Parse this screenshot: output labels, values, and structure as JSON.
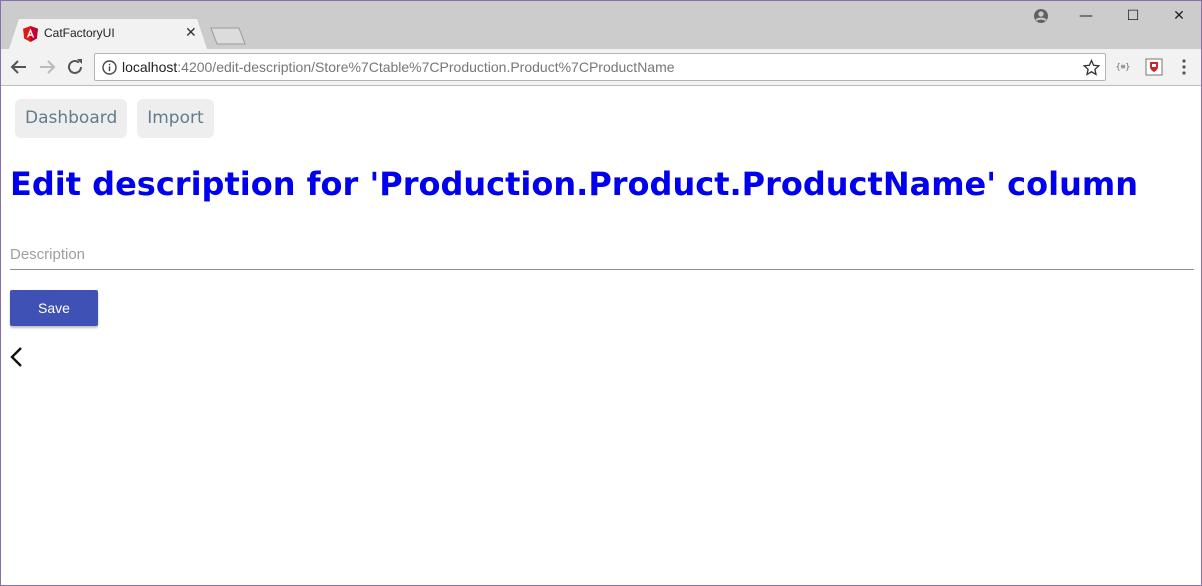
{
  "browser": {
    "tab_title": "CatFactoryUI",
    "url_host": "localhost",
    "url_rest": ":4200/edit-description/Store%7Ctable%7CProduction.Product%7CProductName",
    "window_controls": {
      "minimize": "—",
      "maximize": "☐",
      "close": "✕"
    },
    "extension_label": "{≡}"
  },
  "nav": {
    "items": [
      {
        "label": "Dashboard"
      },
      {
        "label": "Import"
      }
    ]
  },
  "page": {
    "heading": "Edit description for 'Production.Product.ProductName' column",
    "description_placeholder": "Description",
    "description_value": "",
    "save_label": "Save"
  },
  "colors": {
    "heading": "#0000ee",
    "save_button": "#3f51b5",
    "nav_text": "#607d8b"
  },
  "icons": [
    "angular-favicon-icon",
    "close-icon",
    "new-tab-icon",
    "profile-icon",
    "back-arrow-icon",
    "forward-arrow-icon",
    "reload-icon",
    "info-icon",
    "star-icon",
    "json-extension-icon",
    "shield-extension-icon",
    "menu-icon",
    "chevron-left-icon"
  ]
}
